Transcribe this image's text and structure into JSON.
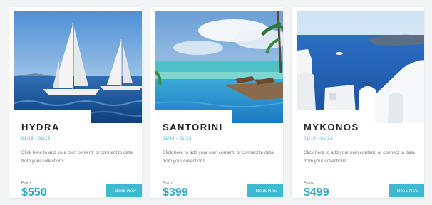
{
  "cards": [
    {
      "title": "HYDRA",
      "dates": "01/19 - 01/23",
      "description": "Click here to add your own content, or connect to data from your collections.",
      "from_label": "From:",
      "price": "$550",
      "button_label": "Book Now",
      "image": "sailboats-on-sea"
    },
    {
      "title": "SANTORINI",
      "dates": "01/19 - 01/23",
      "description": "Click here to add your own content, or connect to data from your collections.",
      "from_label": "From:",
      "price": "$399",
      "button_label": "Book Now",
      "image": "infinity-pool-beach"
    },
    {
      "title": "MYKONOS",
      "dates": "01/19 - 01/23",
      "description": "Click here to add your own content, or connect to data from your collections.",
      "from_label": "From:",
      "price": "$499",
      "button_label": "Book Now",
      "image": "white-houses-blue-sea"
    }
  ],
  "colors": {
    "accent": "#3dbad1",
    "price": "#2fa9c6",
    "background": "#f3f4f6"
  }
}
